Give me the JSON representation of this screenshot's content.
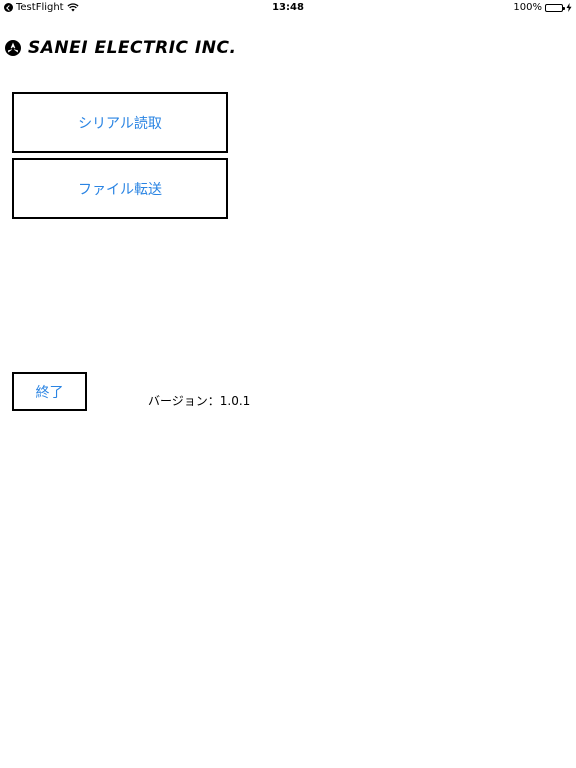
{
  "status_bar": {
    "back_app": "TestFlight",
    "time": "13:48",
    "battery": "100%",
    "battery_level": 1.0,
    "icons": [
      "back-icon",
      "wifi-icon",
      "battery-icon",
      "charging-icon"
    ]
  },
  "header": {
    "logo_text": "SANEI ELECTRIC INC."
  },
  "buttons": {
    "serial_read": "シリアル読取",
    "file_transfer": "ファイル転送",
    "exit": "終了"
  },
  "footer": {
    "version": "バージョン：1.0.1"
  },
  "colors": {
    "accent": "#2a84e3",
    "battery": "#4cd964"
  }
}
